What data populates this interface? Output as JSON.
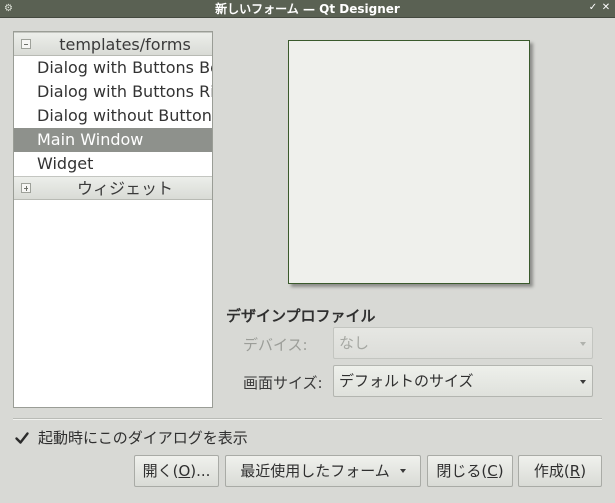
{
  "window": {
    "title": "新しいフォーム — Qt Designer",
    "app_icon": "qt-designer-icon",
    "controls": [
      "minimize-icon",
      "close-icon"
    ]
  },
  "tree": {
    "categories": [
      {
        "label": "templates/forms",
        "expanded": true,
        "items": [
          {
            "label": "Dialog with Buttons Bo…",
            "selected": false
          },
          {
            "label": "Dialog with Buttons Ri…",
            "selected": false
          },
          {
            "label": "Dialog without Buttons",
            "selected": false
          },
          {
            "label": "Main Window",
            "selected": true
          },
          {
            "label": "Widget",
            "selected": false
          }
        ]
      },
      {
        "label": "ウィジェット",
        "expanded": false,
        "items": []
      }
    ]
  },
  "profile": {
    "title": "デザインプロファイル",
    "device_label": "デバイス:",
    "device_value": "なし",
    "screen_size_label": "画面サイズ:",
    "screen_size_value": "デフォルトのサイズ"
  },
  "startup_checkbox": {
    "label": "起動時にこのダイアログを表示",
    "checked": true
  },
  "buttons": {
    "open": {
      "pre": "開く(",
      "mnemonic": "O",
      "post": ")..."
    },
    "recent": {
      "label": "最近使用したフォーム"
    },
    "close": {
      "pre": "閉じる(",
      "mnemonic": "C",
      "post": ")"
    },
    "create": {
      "pre": "作成(",
      "mnemonic": "R",
      "post": ")"
    }
  },
  "colors": {
    "titlebar": "#5a6153",
    "selection": "#8e918c",
    "preview_border": "#3a5a2c",
    "background": "#d8d9d5"
  }
}
